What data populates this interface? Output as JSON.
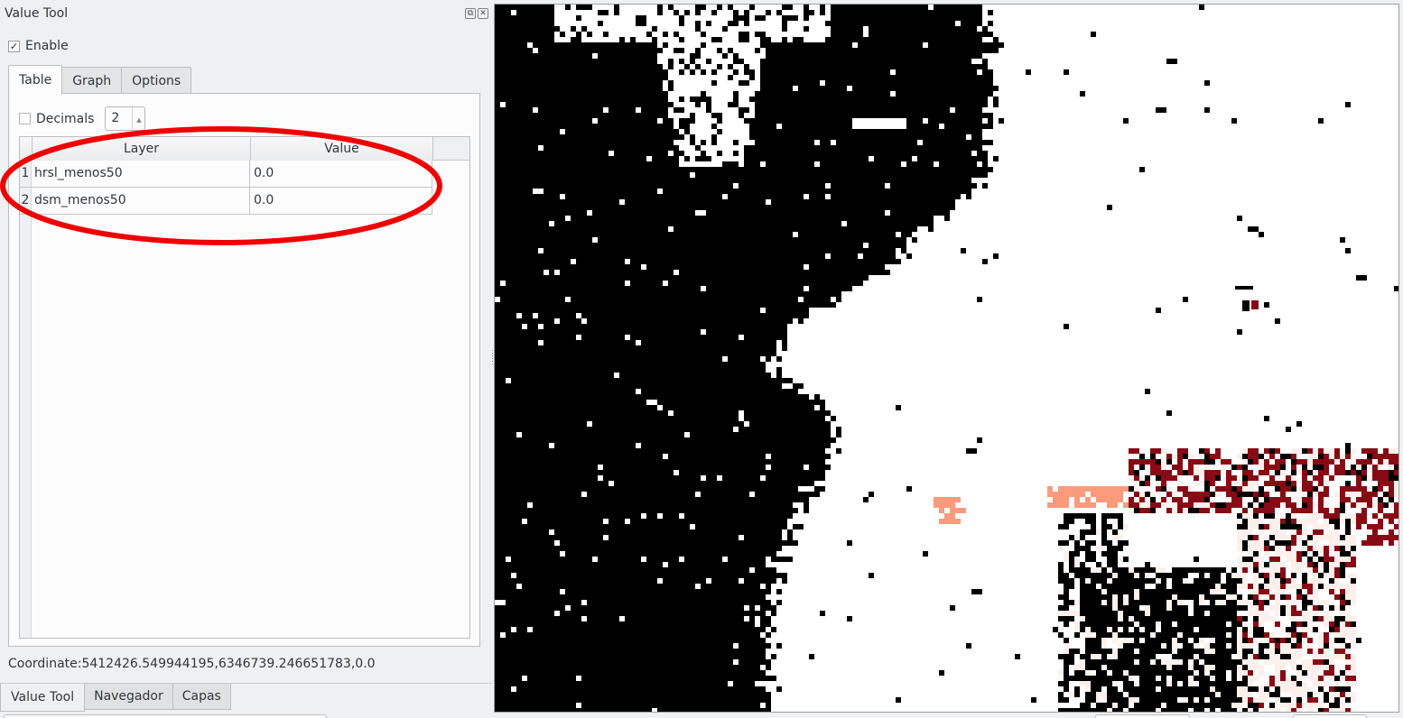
{
  "dock": {
    "title": "Value Tool",
    "float_icon": "float-icon",
    "close_icon": "close-icon",
    "enable": {
      "label": "Enable",
      "checked": true
    },
    "tabs": [
      {
        "label": "Table",
        "active": true
      },
      {
        "label": "Graph",
        "active": false
      },
      {
        "label": "Options",
        "active": false
      }
    ],
    "table_tab": {
      "decimals": {
        "label": "Decimals",
        "checked": false,
        "value": "2"
      },
      "columns": [
        "Layer",
        "Value"
      ],
      "rows": [
        {
          "num": "1",
          "layer": "hrsl_menos50",
          "value": "0.0"
        },
        {
          "num": "2",
          "layer": "dsm_menos50",
          "value": "0.0"
        }
      ]
    },
    "coordinate": "Coordinate:5412426.549944195,6346739.246651783,0.0",
    "bottom_tabs": [
      {
        "label": "Value Tool",
        "active": true
      },
      {
        "label": "Navegador",
        "active": false
      },
      {
        "label": "Capas",
        "active": false
      }
    ]
  },
  "annotation": {
    "shape": "ellipse",
    "color": "#ee0000",
    "target": "layer-value-rows"
  },
  "map": {
    "type": "raster",
    "palette": {
      "nodata_black": "#000000",
      "background_white": "#ffffff",
      "light_pink": "#fdf0ec",
      "salmon": "#fc9a7c",
      "dark_red": "#870a14"
    }
  }
}
